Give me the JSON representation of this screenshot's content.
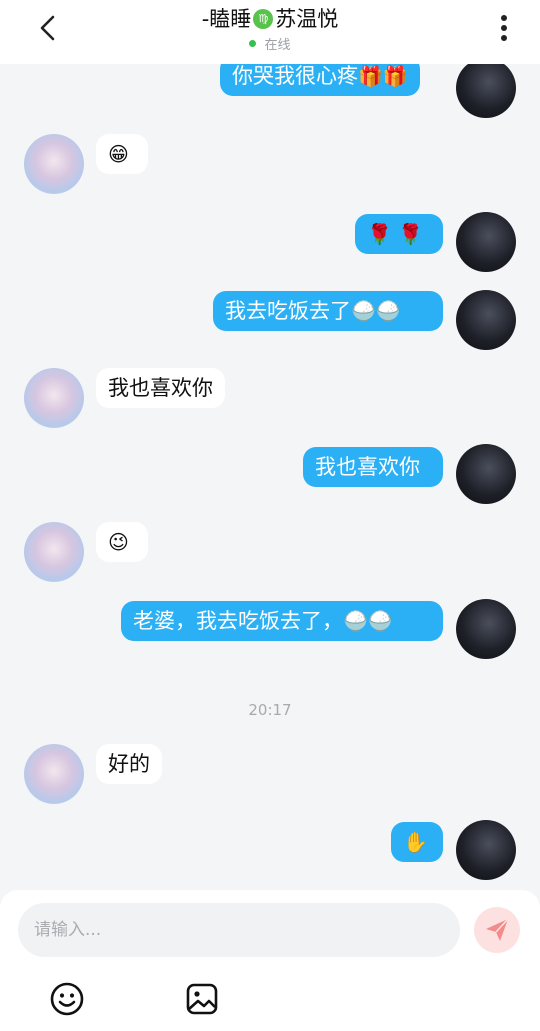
{
  "header": {
    "title_prefix": "-瞌睡",
    "zodiac_symbol": "♍",
    "title_suffix": "苏温悦",
    "status": "在线"
  },
  "messages": [
    {
      "side": "out",
      "text": "你哭我很心疼",
      "emoji": "🎁🎁"
    },
    {
      "side": "in",
      "text": "",
      "emoji": "😁"
    },
    {
      "side": "out",
      "text": "",
      "emoji": "🌹 🌹"
    },
    {
      "side": "out",
      "text": "我去吃饭去了",
      "emoji": "🍚🍚"
    },
    {
      "side": "in",
      "text": "我也喜欢你",
      "emoji": ""
    },
    {
      "side": "out",
      "text": "我也喜欢你",
      "emoji": ""
    },
    {
      "side": "in",
      "text": "",
      "emoji": "😉"
    },
    {
      "side": "out",
      "text": "老婆，我去吃饭去了，",
      "emoji": "🍚🍚"
    },
    {
      "side": "in",
      "text": "好的",
      "emoji": ""
    },
    {
      "side": "out",
      "text": "",
      "emoji": "✋"
    }
  ],
  "timestamp": "20:17",
  "input": {
    "placeholder": "请输入..."
  },
  "icons": {
    "back": "chevron-left-icon",
    "more": "more-vertical-icon",
    "send": "send-icon",
    "emoji": "emoji-icon",
    "image": "image-icon"
  },
  "colors": {
    "outgoing_bubble": "#2bb0f5",
    "incoming_bubble": "#ffffff",
    "online_dot": "#35c04d",
    "send_button": "#fde1e1",
    "send_icon": "#f28b8b"
  }
}
